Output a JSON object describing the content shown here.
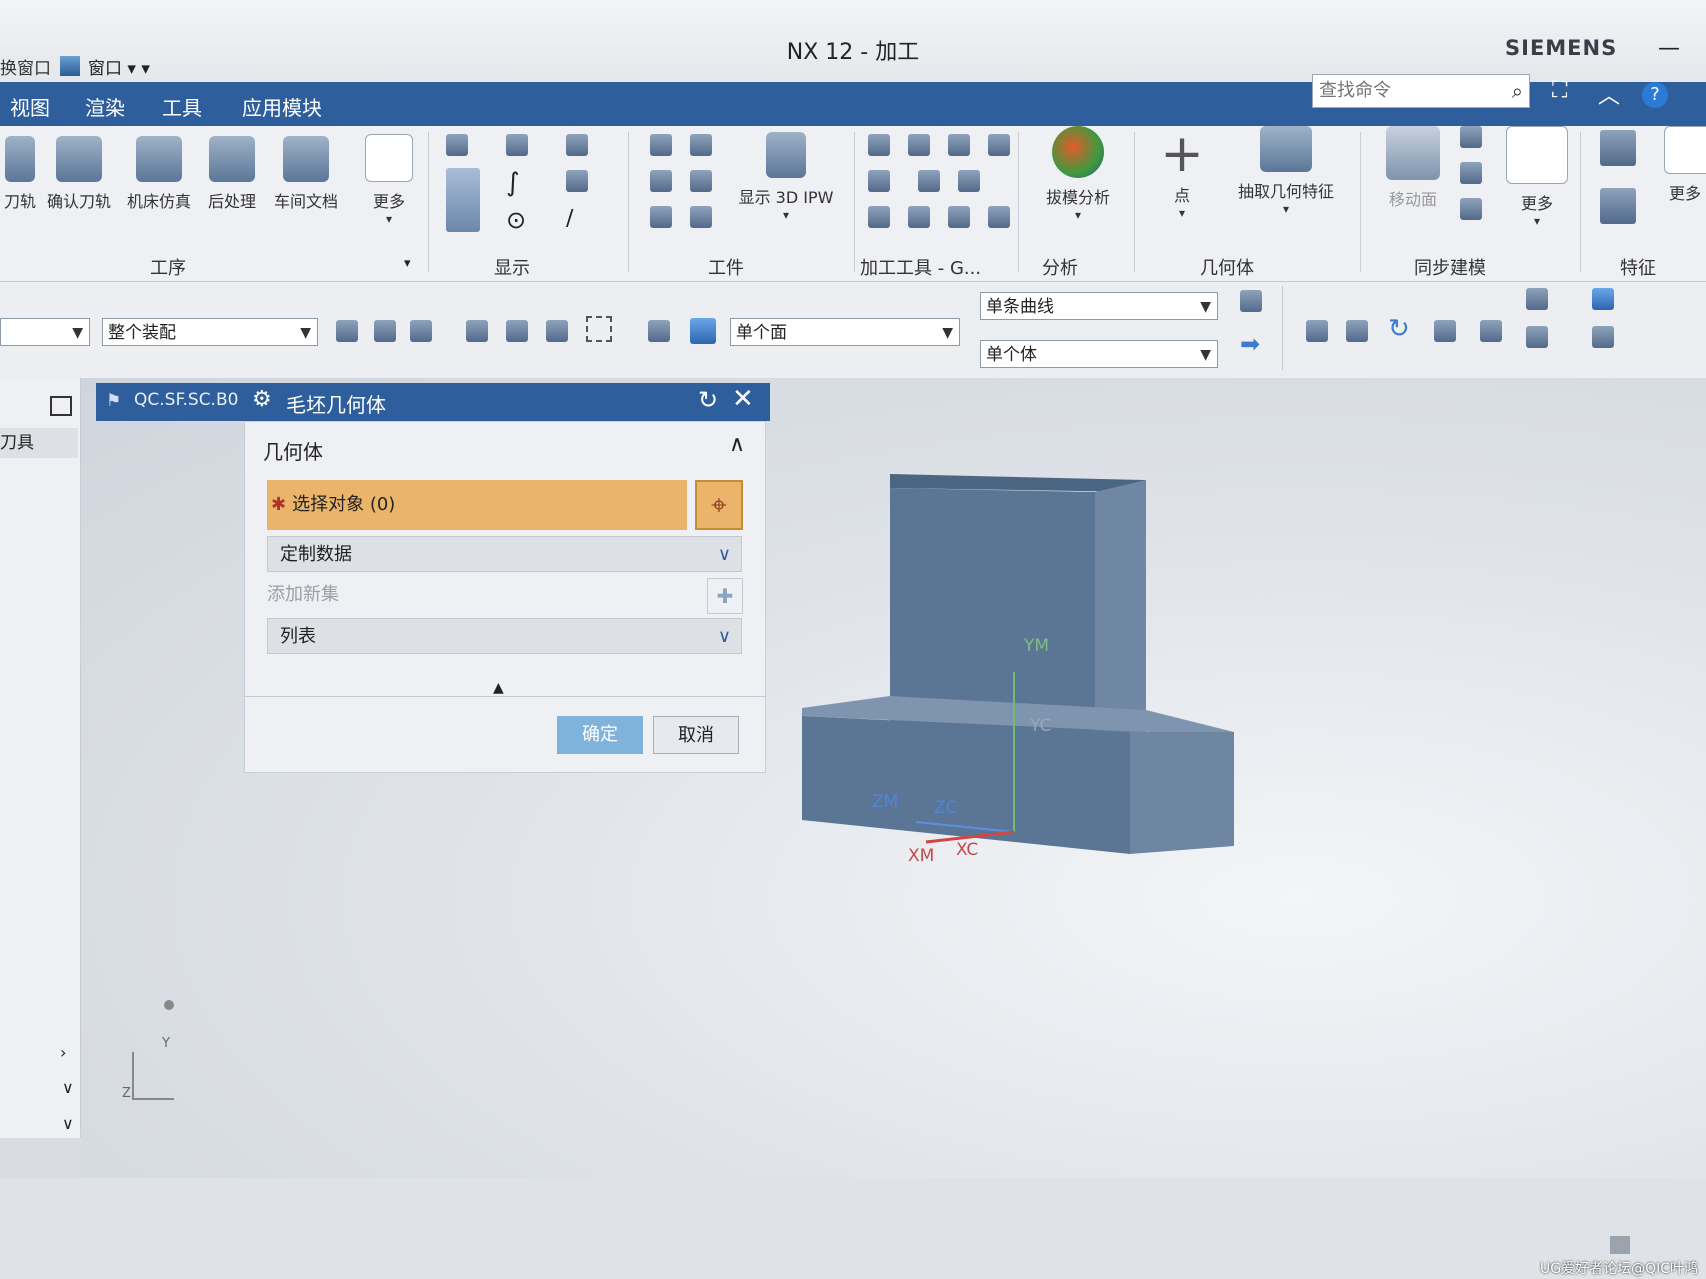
{
  "titlebar": {
    "quick_access": "换窗口",
    "window_menu": "窗口 ▾ ▾",
    "title": "NX 12 - 加工",
    "brand": "SIEMENS"
  },
  "menubar": {
    "items": [
      "视图",
      "渲染",
      "工具",
      "应用模块"
    ],
    "search_placeholder": "查找命令"
  },
  "ribbon": {
    "process_group": {
      "buttons": [
        "刀轨",
        "确认刀轨",
        "机床仿真",
        "后处理",
        "车间文档",
        "更多"
      ],
      "label": "工序"
    },
    "display_group": {
      "label": "显示"
    },
    "workpiece_group": {
      "buttons": [
        "显示 3D IPW"
      ],
      "label": "工件"
    },
    "tools_group": {
      "label": "加工工具 - G..."
    },
    "analysis_group": {
      "buttons": [
        "拔模分析"
      ],
      "label": "分析"
    },
    "geometry_group": {
      "buttons": [
        "点",
        "抽取几何特征"
      ],
      "label": "几何体"
    },
    "sync_group": {
      "buttons": [
        "移动面",
        "更多"
      ],
      "label": "同步建模"
    },
    "feature_group": {
      "buttons": [
        "更多"
      ],
      "label": "特征"
    }
  },
  "toolbar2": {
    "assembly_filter": "整个装配",
    "face_rule": "单个面",
    "curve_rule": "单条曲线",
    "body_rule": "单个体"
  },
  "nav": {
    "tool_label": "刀具"
  },
  "tab": {
    "file": "QC.SF.SC.B0"
  },
  "dialog": {
    "title": "毛坯几何体",
    "section": "几何体",
    "select_object": "选择对象 (0)",
    "custom_data": "定制数据",
    "add_new_set": "添加新集",
    "list": "列表",
    "ok": "确定",
    "cancel": "取消"
  },
  "model": {
    "axes": {
      "ym": "YM",
      "yc": "YC",
      "zm": "ZM",
      "zc": "ZC",
      "xm": "XM",
      "xc": "XC"
    }
  },
  "triad": {
    "y": "Y",
    "z": "Z"
  },
  "watermark": "UG爱好者论坛@QIC叶鸿"
}
